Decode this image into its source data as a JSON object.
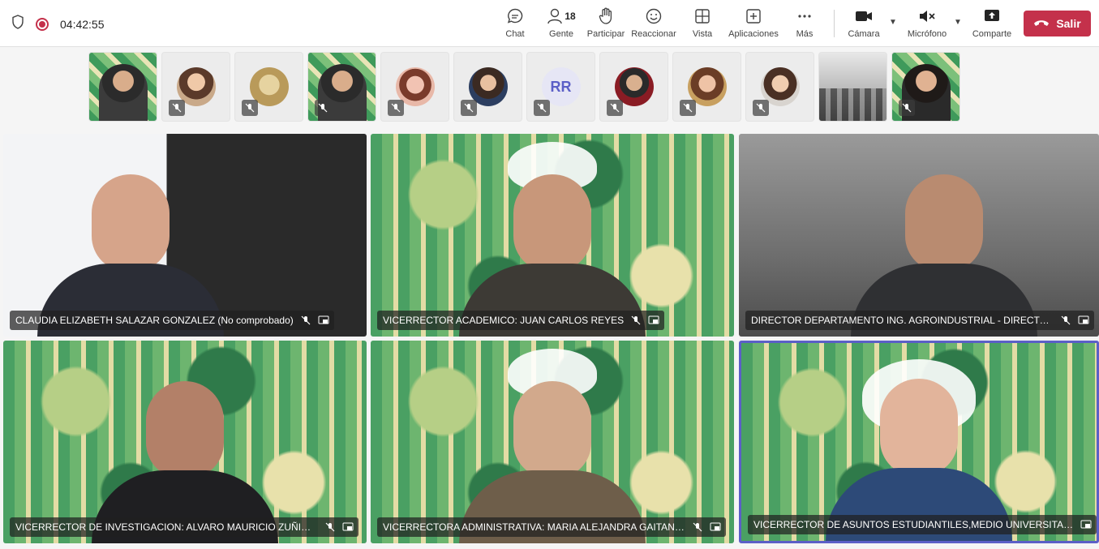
{
  "status": {
    "timer": "04:42:55"
  },
  "toolbar": {
    "chat": "Chat",
    "people": "Gente",
    "people_count": "18",
    "raise": "Participar",
    "react": "Reaccionar",
    "view": "Vista",
    "apps": "Aplicaciones",
    "more": "Más",
    "camera": "Cámara",
    "mic": "Micrófono",
    "share": "Comparte",
    "leave": "Salir"
  },
  "thumbnails": [
    {
      "type": "green-person",
      "muted": false
    },
    {
      "type": "avatar",
      "muted": true
    },
    {
      "type": "avatar",
      "muted": true
    },
    {
      "type": "green-person",
      "muted": true
    },
    {
      "type": "avatar",
      "muted": true
    },
    {
      "type": "avatar",
      "muted": true
    },
    {
      "type": "initials",
      "initials": "RR",
      "muted": true
    },
    {
      "type": "avatar",
      "muted": true
    },
    {
      "type": "avatar",
      "muted": true
    },
    {
      "type": "avatar",
      "muted": true
    },
    {
      "type": "room",
      "muted": false
    },
    {
      "type": "green-person",
      "muted": true
    }
  ],
  "tiles": [
    {
      "name": "CLAUDIA ELIZABETH SALAZAR GONZALEZ (No comprobado)",
      "bg": "office",
      "muted": true
    },
    {
      "name": "VICERRECTOR ACADEMICO: JUAN CARLOS REYES",
      "bg": "green",
      "muted": true
    },
    {
      "name": "DIRECTOR DEPARTAMENTO ING. AGROINDUSTRIAL - DIRECTOR (E)...",
      "bg": "grey",
      "muted": true
    },
    {
      "name": "VICERRECTOR DE INVESTIGACION: ALVARO MAURICIO ZUÑIGA M...",
      "bg": "green",
      "muted": true
    },
    {
      "name": "VICERRECTORA ADMINISTRATIVA: MARIA ALEJANDRA GAITAN CA...",
      "bg": "green",
      "muted": true
    },
    {
      "name": "VICERRECTOR DE ASUNTOS ESTUDIANTILES,MEDIO UNIVERSITARIO E I...",
      "bg": "green",
      "muted": false
    }
  ],
  "colors": {
    "leave": "#c4314b",
    "active_border": "#5b5fc7",
    "record": "#c4314b"
  }
}
